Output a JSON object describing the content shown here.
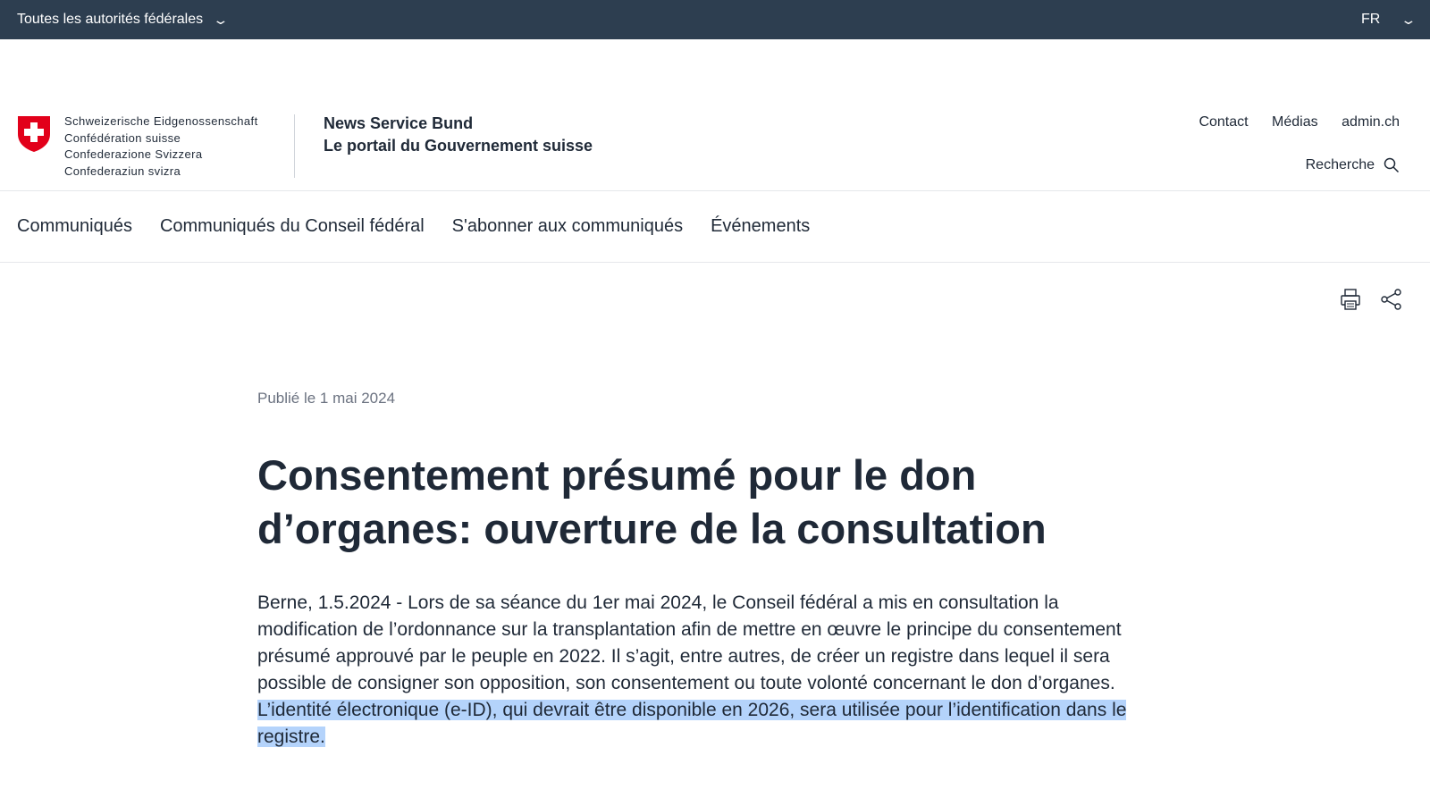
{
  "topbar": {
    "authorities": "Toutes les autorités fédérales",
    "language": "FR"
  },
  "header": {
    "confederation": [
      "Schweizerische Eidgenossenschaft",
      "Confédération suisse",
      "Confederazione Svizzera",
      "Confederaziun svizra"
    ],
    "site_title": "News Service Bund",
    "site_subtitle": "Le portail du Gouvernement suisse",
    "links": [
      "Contact",
      "Médias",
      "admin.ch"
    ],
    "search_label": "Recherche"
  },
  "nav": [
    "Communiqués",
    "Communiqués du Conseil fédéral",
    "S'abonner aux communiqués",
    "Événements"
  ],
  "article": {
    "published": "Publié le 1 mai 2024",
    "title_line1": "Consentement présumé pour le don",
    "title_line2": "d’organes: ouverture de la consultation",
    "lead_plain": "Berne, 1.5.2024 - Lors de sa séance du 1er mai 2024, le Conseil fédéral a mis en consultation la modification de l’ordonnance sur la transplantation afin de mettre en œuvre le principe du consentement présumé approuvé par le peuple en 2022. Il s’agit, entre autres, de créer un registre dans lequel il sera possible de consigner son opposition, son consentement ou toute volonté concernant le don d’organes. ",
    "lead_selected": "L’identité électronique (e-ID), qui devrait être disponible en 2026, sera utilisée pour l’identification dans le registre."
  },
  "colors": {
    "topbar": "#2d3e50",
    "swiss_red": "#e2001a",
    "selection": "#b4d3fb"
  }
}
